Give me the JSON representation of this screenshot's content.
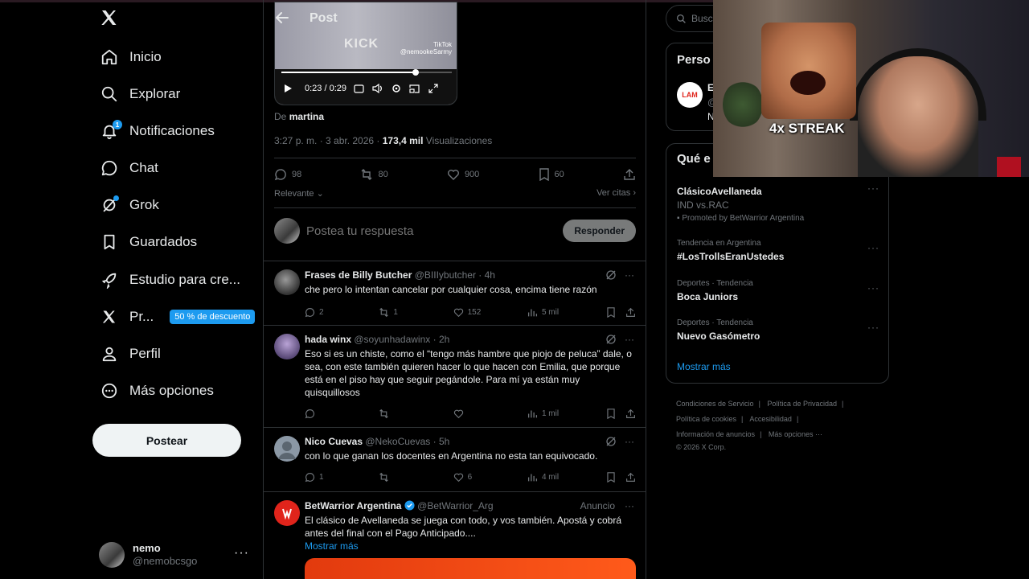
{
  "sidebar": {
    "items": [
      {
        "label": "Inicio",
        "icon": "home-icon"
      },
      {
        "label": "Explorar",
        "icon": "search-icon"
      },
      {
        "label": "Notificaciones",
        "icon": "bell-icon",
        "badge": "1"
      },
      {
        "label": "Chat",
        "icon": "chat-icon"
      },
      {
        "label": "Grok",
        "icon": "grok-icon"
      },
      {
        "label": "Guardados",
        "icon": "bookmark-icon"
      },
      {
        "label": "Estudio para cre...",
        "icon": "rocket-icon"
      },
      {
        "label": "Pr...",
        "icon": "x-premium-icon",
        "promo": "50 % de descuento"
      },
      {
        "label": "Perfil",
        "icon": "person-icon"
      },
      {
        "label": "Más opciones",
        "icon": "more-circle-icon"
      }
    ],
    "post_button": "Postear",
    "account": {
      "name": "nemo",
      "handle": "@nemobcsgo",
      "more": "···"
    }
  },
  "main": {
    "header_title": "Post",
    "video": {
      "overlay_text": "KICK",
      "tiktok_label": "TikTok",
      "tiktok_handle": "@nemookeSarmy",
      "time": "0:23 / 0:29",
      "progress": 0.79
    },
    "byline_prefix": "De",
    "byline_author": "martina",
    "meta_time": "3:27 p. m. · 3 abr. 2026 · ",
    "meta_views": "173,4 mil",
    "meta_views_label": " Visualizaciones",
    "stats": {
      "replies": "98",
      "reposts": "80",
      "likes": "900",
      "bookmarks": "60"
    },
    "sort_label": "Relevante",
    "quotes_label": "Ver citas",
    "reply_placeholder": "Postea tu respuesta",
    "reply_button": "Responder",
    "replies": [
      {
        "name": "Frases de Billy Butcher",
        "handle": "@BIIIybutcher",
        "time": "· 4h",
        "text": "che pero lo intentan cancelar por cualquier cosa, encima tiene razón",
        "replies": "2",
        "reposts": "1",
        "likes": "152",
        "views": "5 mil"
      },
      {
        "name": "hada winx",
        "handle": "@soyunhadawinx",
        "time": "· 2h",
        "text": "Eso si es un chiste, como el “tengo más hambre que piojo de peluca” dale, o sea, con este también quieren hacer lo que hacen con Emilia, que porque está en el piso hay que seguir pegándole. Para mí ya están muy quisquillosos",
        "replies": "",
        "reposts": "",
        "likes": "",
        "views": "1 mil"
      },
      {
        "name": "Nico Cuevas",
        "handle": "@NekoCuevas",
        "time": "· 5h",
        "text": "con lo que ganan los docentes en Argentina no esta tan equivocado.",
        "replies": "1",
        "reposts": "",
        "likes": "6",
        "views": "4 mil"
      }
    ],
    "ad": {
      "name": "BetWarrior Argentina",
      "handle": "@BetWarrior_Arg",
      "label": "Anuncio",
      "text": "El clásico de Avellaneda se juega con todo, y vos también. Apostá y cobrá antes del final con el Pago Anticipado....",
      "show_more": "Mostrar más"
    }
  },
  "right": {
    "search_placeholder": "Busca",
    "who_to_follow_title": "Perso",
    "follow_avatar_text": "LAM",
    "follow_name": "E",
    "follow_handle": "@",
    "follow_desc": "N",
    "trends_title": "Qué e",
    "trends": [
      {
        "meta": "",
        "name": "ClásicoAvellaneda",
        "sub": "IND vs.RAC",
        "promo": "Promoted by BetWarrior Argentina"
      },
      {
        "meta": "Tendencia en Argentina",
        "name": "#LosTrollsEranUstedes"
      },
      {
        "meta": "Deportes · Tendencia",
        "name": "Boca Juniors"
      },
      {
        "meta": "Deportes · Tendencia",
        "name": "Nuevo Gasómetro"
      }
    ],
    "show_more": "Mostrar más",
    "footer": [
      "Condiciones de Servicio",
      "|",
      "Política de Privacidad",
      "|",
      "Política de cookies",
      "|",
      "Accesibilidad",
      "|",
      "Información de anuncios",
      "|",
      "Más opciones ···",
      "© 2026 X Corp."
    ]
  },
  "overlay": {
    "streak_text": "4x STREAK"
  },
  "colors": {
    "accent": "#1d9bf0",
    "background": "#000000",
    "border": "#2f3336",
    "muted": "#71767b"
  }
}
